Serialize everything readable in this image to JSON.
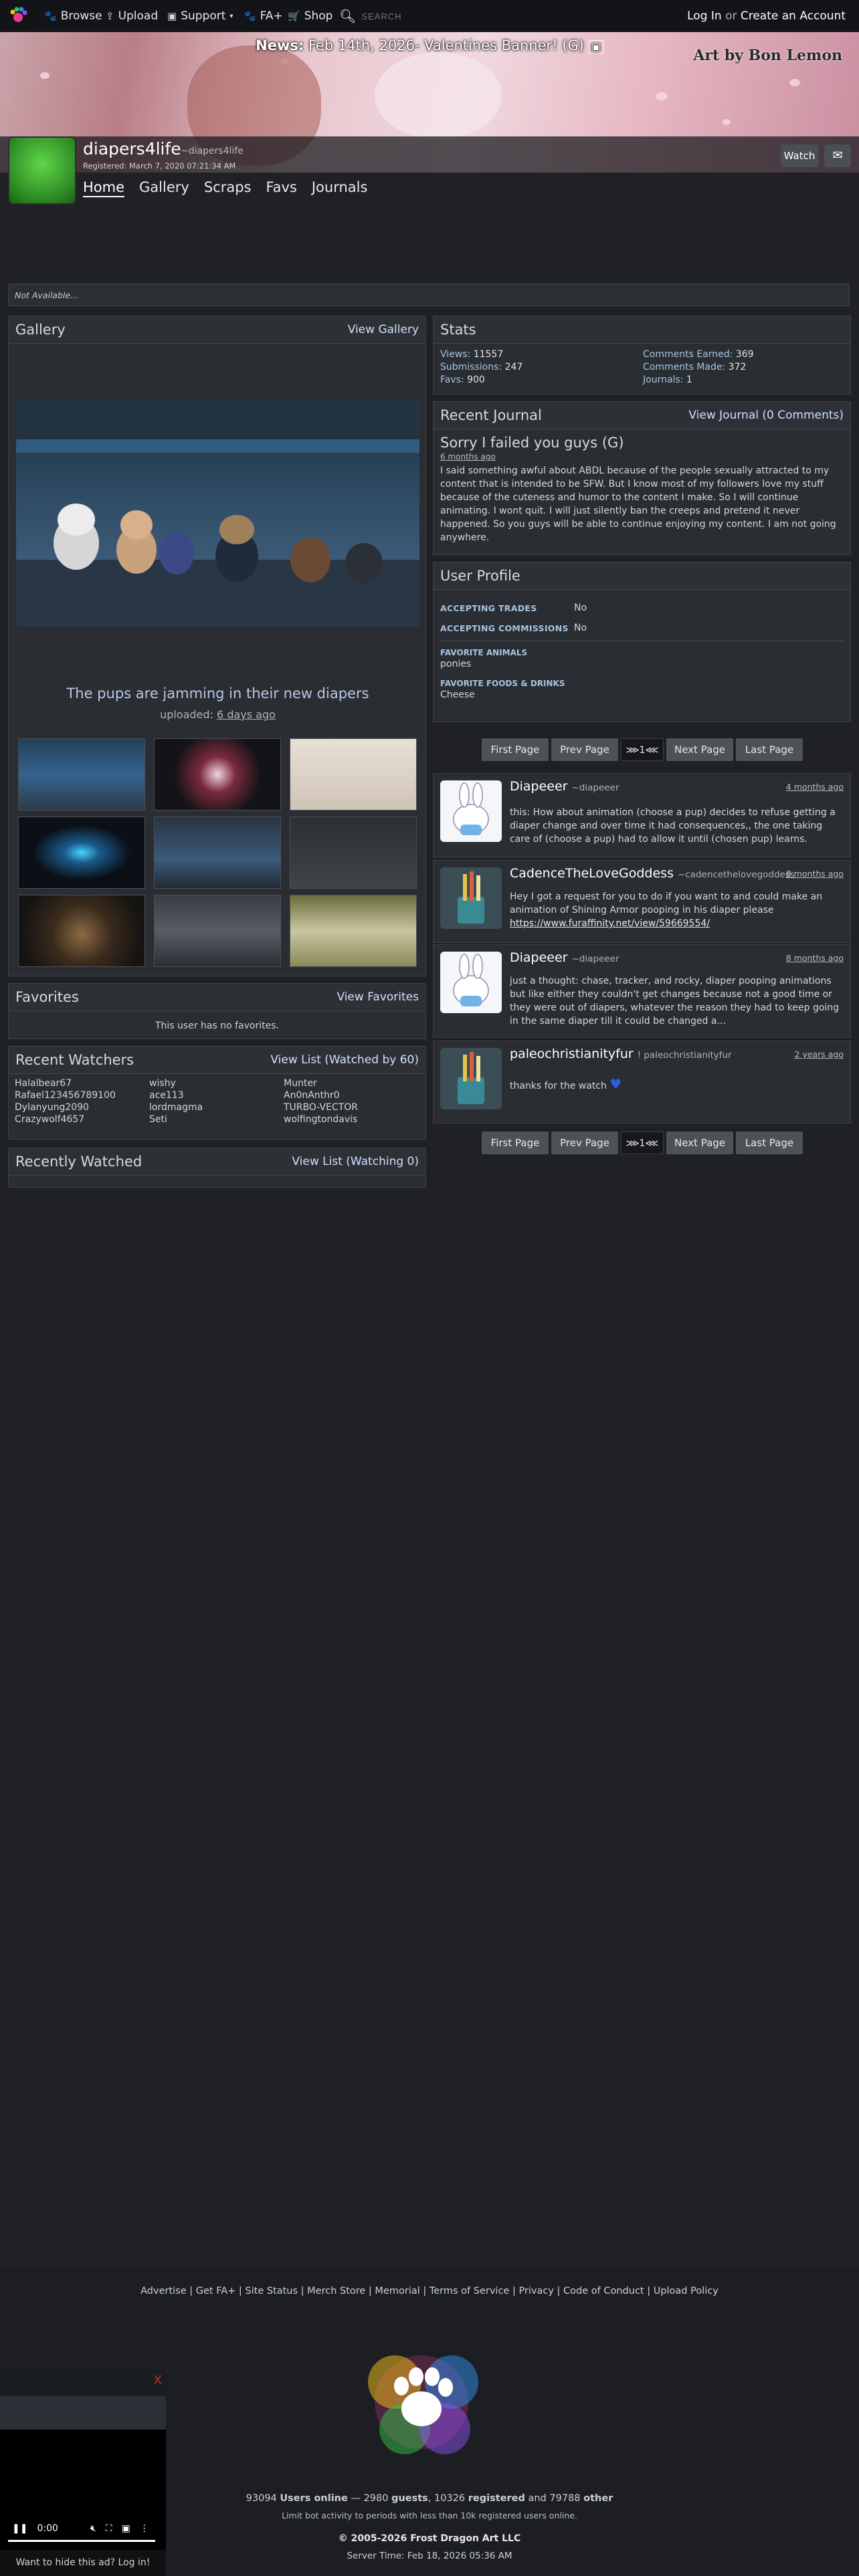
{
  "topnav": {
    "browse": "Browse",
    "upload": "Upload",
    "support": "Support",
    "fa_plus": "FA+",
    "shop": "Shop",
    "search_placeholder": "SEARCH",
    "login": "Log In",
    "or": "or",
    "create": "Create an Account"
  },
  "banner": {
    "news_label": "News:",
    "news_text": "Feb 14th, 2026- Valentines Banner! (G)",
    "art_by": "Art by Bon Lemon"
  },
  "profile": {
    "username": "diapers4life",
    "handle": "~diapers4life",
    "registered": "Registered: March 7, 2020 07:21:34 AM",
    "watch": "Watch"
  },
  "subnav": [
    "Home",
    "Gallery",
    "Scraps",
    "Favs",
    "Journals"
  ],
  "notice": "Not Available...",
  "gallery": {
    "title": "Gallery",
    "link": "View Gallery",
    "caption": "The pups are jamming in their new diapers",
    "uploaded_label": "uploaded:",
    "uploaded_value": "6 days ago"
  },
  "favorites": {
    "title": "Favorites",
    "link": "View Favorites",
    "empty": "This user has no favorites."
  },
  "watchers": {
    "title": "Recent Watchers",
    "link": "View List (Watched by 60)",
    "names": [
      "Halalbear67",
      "wishy",
      "Munter",
      "Rafael123456789100",
      "ace113",
      "An0nAnthr0",
      "Dylanyung2090",
      "lordmagma",
      "TURBO-VECTOR",
      "Crazywolf4657",
      "Seti",
      "wolfingtondavis"
    ]
  },
  "recently_watched": {
    "title": "Recently Watched",
    "link": "View List (Watching 0)"
  },
  "stats": {
    "title": "Stats",
    "views_label": "Views:",
    "views": "11557",
    "submissions_label": "Submissions:",
    "submissions": "247",
    "favs_label": "Favs:",
    "favs": "900",
    "comments_earned_label": "Comments Earned:",
    "comments_earned": "369",
    "comments_made_label": "Comments Made:",
    "comments_made": "372",
    "journals_label": "Journals:",
    "journals": "1"
  },
  "journal": {
    "title": "Recent Journal",
    "link": "View Journal (0 Comments)",
    "heading": "Sorry I failed you guys (G)",
    "date": "6 months ago",
    "body": "I said something awful about ABDL because of the people sexually attracted to my content that is intended to be SFW. But I know most of my followers love my stuff because of the cuteness and humor to the content I make. So I will continue animating. I wont quit. I will just silently ban the creeps and pretend it never happened. So you guys will be able to continue enjoying my content. I am not going anywhere."
  },
  "user_profile": {
    "title": "User Profile",
    "trades_label": "ACCEPTING TRADES",
    "trades": "No",
    "commissions_label": "ACCEPTING COMMISSIONS",
    "commissions": "No",
    "animals_label": "FAVORITE ANIMALS",
    "animals": "ponies",
    "foods_label": "FAVORITE FOODS & DRINKS",
    "foods": "Cheese"
  },
  "pager": {
    "first": "First Page",
    "prev": "Prev Page",
    "current": "1",
    "next": "Next Page",
    "last": "Last Page"
  },
  "comments": [
    {
      "name": "Diapeeer",
      "handle": "~diapeeer",
      "time": "4 months ago",
      "text": "this: How about animation (choose a pup) decides to refuse getting a diaper change and over time it had consequences,, the one taking care of (choose a pup) had to allow it until (chosen pup) learns."
    },
    {
      "name": "CadenceTheLoveGoddess",
      "handle": "~cadencethelovegoddess",
      "time": "8 months ago",
      "text": "Hey I got a request for you to do if you want to and could make an animation of Shining Armor pooping in his diaper please",
      "link": "https://www.furaffinity.net/view/59669554/"
    },
    {
      "name": "Diapeeer",
      "handle": "~diapeeer",
      "time": "8 months ago",
      "text": "just a thought: chase, tracker, and rocky, diaper pooping animations but like either they couldn't get changes because not a good time or they were out of diapers, whatever the reason they had to keep going in the same diaper till it could be changed a..."
    },
    {
      "name": "paleochristianityfur",
      "handle": "! paleochristianityfur",
      "time": "2 years ago",
      "text": "thanks for the watch"
    }
  ],
  "footer": {
    "links": "Advertise | Get FA+ | Site Status | Merch Store | Memorial | Terms of Service | Privacy | Code of Conduct | Upload Policy",
    "users_online": "93094",
    "users_online_label": "Users online",
    "guests": "2980",
    "guests_label": "guests",
    "registered": "10326",
    "registered_label": "registered",
    "other": "79788",
    "other_label": "other",
    "limit": "Limit bot activity to periods with less than 10k registered users online.",
    "copyright": "© 2005-2026 Frost Dragon Art LLC",
    "server_time": "Server Time: Feb 18, 2026 05:36 AM"
  },
  "ad": {
    "close": "X",
    "time": "0:00",
    "hide": "Want to hide this ad? Log in!"
  }
}
